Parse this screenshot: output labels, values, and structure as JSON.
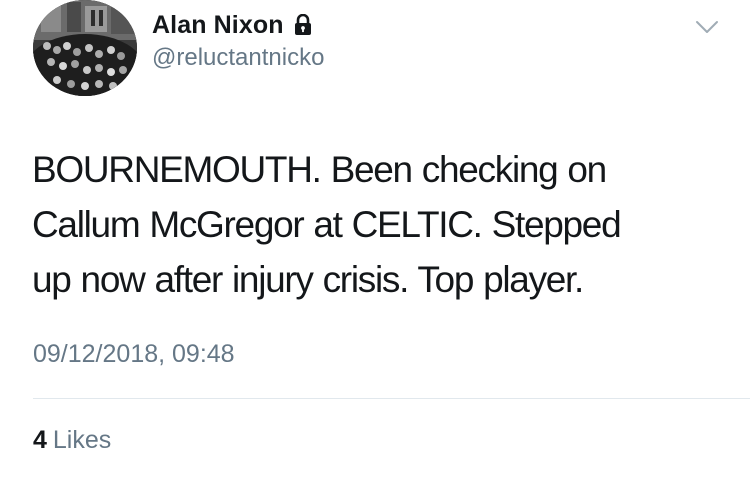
{
  "tweet": {
    "author": {
      "display_name": "Alan Nixon",
      "handle": "@reluctantnicko",
      "protected_icon": "lock-icon"
    },
    "menu_icon": "chevron-down-icon",
    "text_lines": [
      "BOURNEMOUTH. Been checking on",
      "Callum McGregor at CELTIC. Stepped",
      "up now after injury crisis. Top player."
    ],
    "timestamp": "09/12/2018, 09:48",
    "stats": {
      "likes_count": "4",
      "likes_label": "Likes"
    }
  },
  "colors": {
    "text_primary": "#14171a",
    "text_secondary": "#657786",
    "divider": "#e1e8ed"
  }
}
